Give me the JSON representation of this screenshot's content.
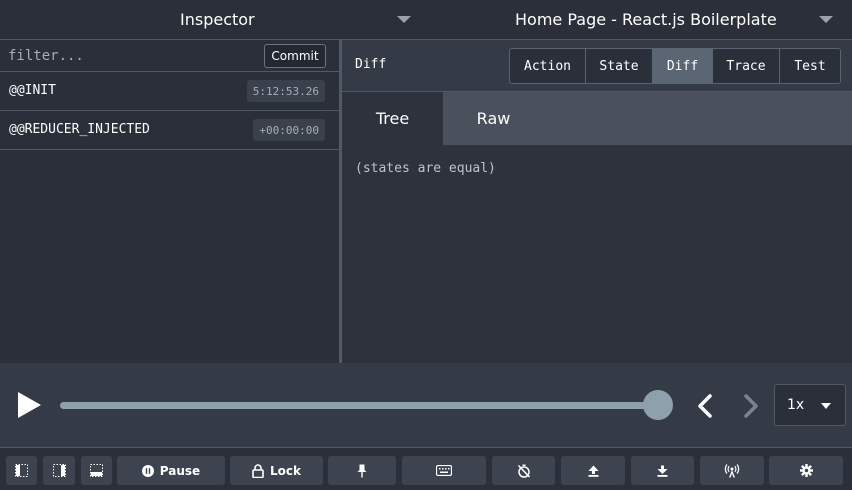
{
  "header": {
    "left_select": "Inspector",
    "right_select": "Home Page - React.js Boilerplate"
  },
  "actions_panel": {
    "filter_placeholder": "filter...",
    "commit_label": "Commit",
    "items": [
      {
        "name": "@@INIT",
        "time": "5:12:53.26"
      },
      {
        "name": "@@REDUCER_INJECTED",
        "time": "+00:00:00"
      }
    ]
  },
  "monitor": {
    "title": "Diff",
    "tabs": [
      "Action",
      "State",
      "Diff",
      "Trace",
      "Test"
    ],
    "active_tab": "Diff",
    "subtabs": [
      "Tree",
      "Raw"
    ],
    "active_subtab": "Tree",
    "message": "(states are equal)"
  },
  "playback": {
    "speed": "1x",
    "progress": 1.0
  },
  "toolbar": {
    "pause_label": "Pause",
    "lock_label": "Lock"
  },
  "icons": {
    "play": "play-icon",
    "prev": "chevron-left-icon",
    "next": "chevron-right-icon",
    "pin": "pin-icon",
    "keyboard": "keyboard-icon",
    "timer": "timer-off-icon",
    "upload": "upload-icon",
    "download": "download-icon",
    "remote": "broadcast-icon",
    "settings": "gear-icon"
  },
  "colors": {
    "background": "#2a2f3a",
    "panel": "#353b46",
    "active_tab": "#5b6674",
    "slider": "#8fa0ad"
  }
}
